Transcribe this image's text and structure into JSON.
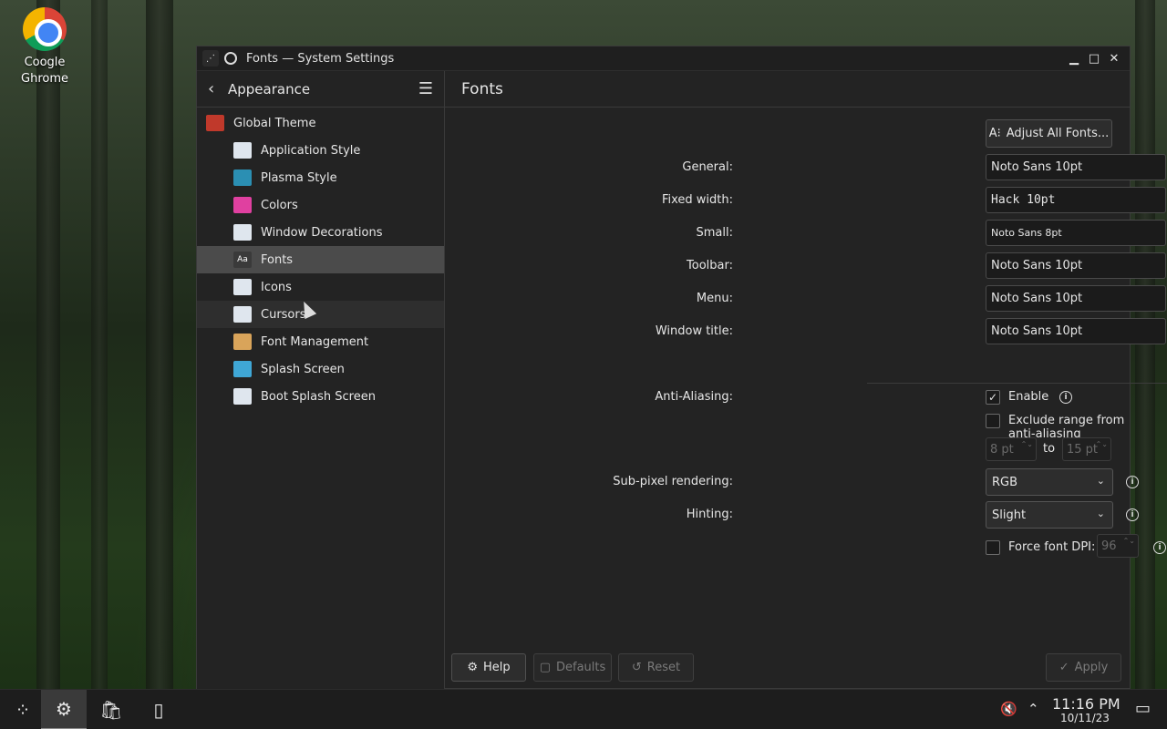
{
  "desktop": {
    "icon_label_line1": "Coogle",
    "icon_label_line2": "Ghrome"
  },
  "window": {
    "title": "Fonts — System Settings",
    "minimize": "▁",
    "maximize": "□",
    "close": "✕"
  },
  "sidebar": {
    "title": "Appearance",
    "back_icon": "‹",
    "menu_icon": "☰",
    "items": [
      {
        "label": "Global Theme",
        "icon_color": "#c0392b"
      },
      {
        "label": "Application Style",
        "icon_color": "#dfe6ee"
      },
      {
        "label": "Plasma Style",
        "icon_color": "#2b8fb3"
      },
      {
        "label": "Colors",
        "icon_color": "#e040a0"
      },
      {
        "label": "Window Decorations",
        "icon_color": "#dfe6ee"
      },
      {
        "label": "Fonts",
        "icon_color": "#3a3a3a",
        "icon_text": "Aa"
      },
      {
        "label": "Icons",
        "icon_color": "#dfe6ee"
      },
      {
        "label": "Cursors",
        "icon_color": "#dfe6ee"
      },
      {
        "label": "Font Management",
        "icon_color": "#d9a45a"
      },
      {
        "label": "Splash Screen",
        "icon_color": "#3fa7d6"
      },
      {
        "label": "Boot Splash Screen",
        "icon_color": "#dfe6ee"
      }
    ]
  },
  "main": {
    "title": "Fonts",
    "adjust_all": "Adjust All Fonts...",
    "adjust_icon": "A⁝",
    "rows": [
      {
        "label": "General:",
        "value": "Noto Sans 10pt"
      },
      {
        "label": "Fixed width:",
        "value": "Hack 10pt"
      },
      {
        "label": "Small:",
        "value": "Noto Sans 8pt"
      },
      {
        "label": "Toolbar:",
        "value": "Noto Sans 10pt"
      },
      {
        "label": "Menu:",
        "value": "Noto Sans 10pt"
      },
      {
        "label": "Window title:",
        "value": "Noto Sans 10pt"
      }
    ],
    "edit_icon": "✎",
    "anti_aliasing_label": "Anti-Aliasing:",
    "enable_label": "Enable",
    "enable_checked": "✓",
    "exclude_label": "Exclude range from anti-aliasing",
    "range_from": "8 pt",
    "range_to_label": "to",
    "range_to": "15 pt",
    "subpixel_label": "Sub-pixel rendering:",
    "subpixel_value": "RGB",
    "hinting_label": "Hinting:",
    "hinting_value": "Slight",
    "force_dpi_label": "Force font DPI:",
    "force_dpi_value": "96",
    "info_glyph": "i",
    "combo_arrow": "⌄",
    "spin_arrows": "⌃⌄"
  },
  "footer": {
    "help": "Help",
    "defaults": "Defaults",
    "reset": "Reset",
    "apply": "Apply",
    "help_icon": "⚙",
    "defaults_icon": "▢",
    "reset_icon": "↺",
    "apply_icon": "✓"
  },
  "taskbar": {
    "launcher_icon": "⁘",
    "settings_icon": "⚙",
    "store_icon": "🛍",
    "file_icon": "▯",
    "mute_icon": "🔇",
    "tray_arrow": "⌃",
    "time": "11:16 PM",
    "date": "10/11/23",
    "show_desktop_icon": "▭"
  }
}
